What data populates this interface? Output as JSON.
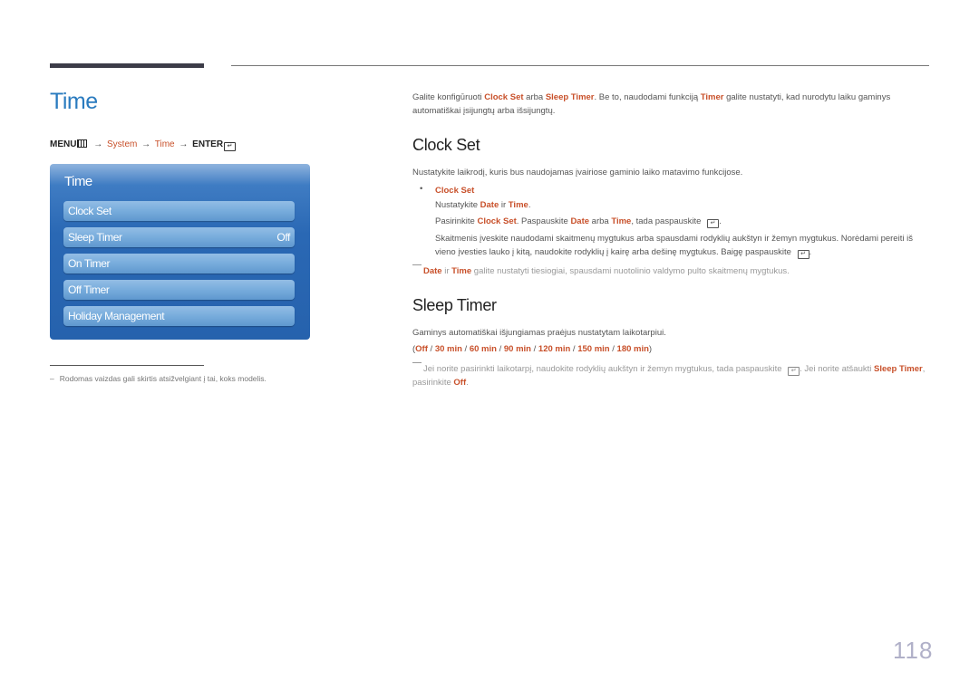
{
  "left": {
    "title": "Time",
    "menu_path": {
      "menu": "MENU",
      "menu_icon": "menu-icon",
      "arrow": "→",
      "system": "System",
      "time": "Time",
      "enter": "ENTER",
      "enter_icon": "↵"
    },
    "menu_box": {
      "title": "Time",
      "items": [
        {
          "label": "Clock Set",
          "value": ""
        },
        {
          "label": "Sleep Timer",
          "value": "Off"
        },
        {
          "label": "On Timer",
          "value": ""
        },
        {
          "label": "Off Timer",
          "value": ""
        },
        {
          "label": "Holiday Management",
          "value": ""
        }
      ]
    },
    "footnote": {
      "dash": "–",
      "text": "Rodomas vaizdas gali skirtis atsižvelgiant į tai, koks modelis."
    }
  },
  "right": {
    "intro": {
      "p1": "Galite konfigūruoti ",
      "clock_set": "Clock Set",
      "p2": " arba ",
      "sleep_timer": "Sleep Timer",
      "p3": ". Be to, naudodami funkciją ",
      "timer": "Timer",
      "p4": " galite nustatyti, kad nurodytu laiku gaminys automatiškai įsijungtų arba išsijungtų."
    },
    "clock_set": {
      "heading": "Clock Set",
      "description": "Nustatykite laikrodį, kuris bus naudojamas įvairiose gaminio laiko matavimo funkcijose.",
      "bullet": "•",
      "bullet_title": "Clock Set",
      "line1": {
        "a": "Nustatykite ",
        "date": "Date",
        "b": " ir ",
        "time": "Time",
        "c": "."
      },
      "line2": {
        "a": "Pasirinkite ",
        "clock_set": "Clock Set",
        "b": ". Paspauskite ",
        "date": "Date",
        "c": " arba ",
        "time": "Time",
        "d": ", tada paspauskite ",
        "icon": "↵",
        "e": "."
      },
      "line3": {
        "a": "Skaitmenis įveskite naudodami skaitmenų mygtukus arba spausdami rodyklių aukštyn ir žemyn mygtukus. Norėdami pereiti iš vieno įvesties lauko į kitą, naudokite rodyklių į kairę arba dešinę mygtukus. Baigę paspauskite ",
        "icon": "↵",
        "b": "."
      },
      "note": {
        "date": "Date",
        "a": " ir ",
        "time": "Time",
        "b": " galite nustatyti tiesiogiai, spausdami nuotolinio valdymo pulto skaitmenų mygtukus."
      }
    },
    "sleep_timer": {
      "heading": "Sleep Timer",
      "description": "Gaminys automatiškai išjungiamas praėjus nustatytam laikotarpiui.",
      "options": [
        "Off",
        "30 min",
        "60 min",
        "90 min",
        "120 min",
        "150 min",
        "180 min"
      ],
      "open_paren": "(",
      "close_paren": ")",
      "separator": " / ",
      "note": {
        "a": "Jei norite pasirinkti laikotarpį, naudokite rodyklių aukštyn ir žemyn mygtukus, tada paspauskite ",
        "icon": "↵",
        "b": ". Jei norite atšaukti ",
        "sleep_timer": "Sleep Timer",
        "c": ", pasirinkite ",
        "off": "Off",
        "d": "."
      }
    }
  },
  "page_number": "118",
  "colors": {
    "accent": "#c8502a",
    "title_blue": "#2a7bbf",
    "menu_blue": "#2662ad"
  }
}
